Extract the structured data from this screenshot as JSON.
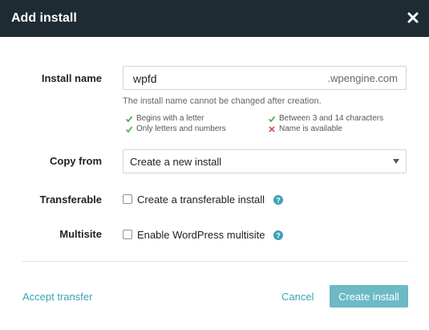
{
  "dialog": {
    "title": "Add install",
    "colors": {
      "header_bg": "#1e2b33",
      "accent": "#3aa3b5",
      "primary_button": "#6db9c6",
      "valid": "#4caf50",
      "invalid": "#d9534f"
    }
  },
  "install_name": {
    "label": "Install name",
    "value": "wpfd",
    "suffix": ".wpengine.com",
    "hint": "The install name cannot be changed after creation.",
    "rules": [
      {
        "text": "Begins with a letter",
        "status": "valid"
      },
      {
        "text": "Between 3 and 14 characters",
        "status": "valid"
      },
      {
        "text": "Only letters and numbers",
        "status": "valid"
      },
      {
        "text": "Name is available",
        "status": "invalid"
      }
    ]
  },
  "copy_from": {
    "label": "Copy from",
    "selected": "Create a new install"
  },
  "transferable": {
    "label": "Transferable",
    "checkbox_label": "Create a transferable install",
    "checked": false
  },
  "multisite": {
    "label": "Multisite",
    "checkbox_label": "Enable WordPress multisite",
    "checked": false
  },
  "footer": {
    "accept_transfer": "Accept transfer",
    "cancel": "Cancel",
    "create": "Create install"
  }
}
